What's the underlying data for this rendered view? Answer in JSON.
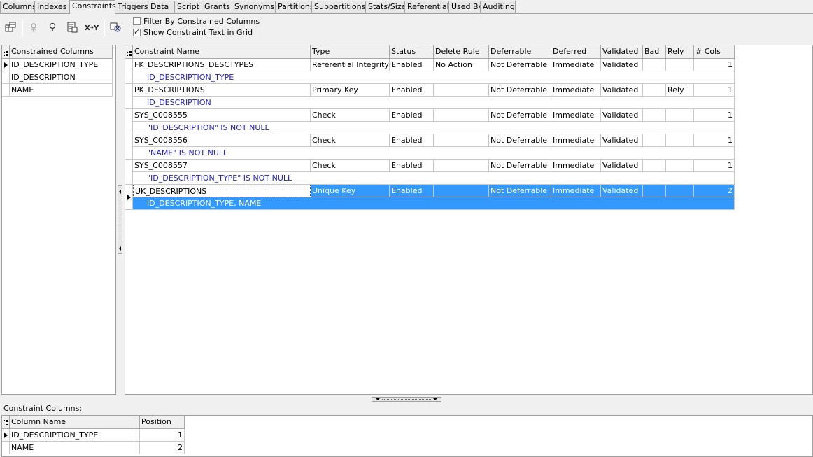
{
  "tabs": [
    "Columns",
    "Indexes",
    "Constraints",
    "Triggers",
    "Data",
    "Script",
    "Grants",
    "Synonyms",
    "Partitions",
    "Subpartitions",
    "Stats/Size",
    "Referential",
    "Used By",
    "Auditing"
  ],
  "active_tab": "Constraints",
  "options": {
    "filter_label": "Filter By Constrained Columns",
    "filter_checked": false,
    "show_text_label": "Show Constraint Text in Grid",
    "show_text_checked": true
  },
  "left_grid": {
    "header": "Constrained Columns",
    "rows": [
      "ID_DESCRIPTION_TYPE",
      "ID_DESCRIPTION",
      "NAME"
    ]
  },
  "main_grid": {
    "headers": [
      "Constraint Name",
      "Type",
      "Status",
      "Delete Rule",
      "Deferrable",
      "Deferred",
      "Validated",
      "Bad",
      "Rely",
      "# Cols"
    ],
    "rows": [
      {
        "name": "FK_DESCRIPTIONS_DESCTYPES",
        "type": "Referential Integrity",
        "status": "Enabled",
        "delete_rule": "No Action",
        "deferrable": "Not Deferrable",
        "deferred": "Immediate",
        "validated": "Validated",
        "bad": "",
        "rely": "",
        "cols": "1",
        "text": "ID_DESCRIPTION_TYPE"
      },
      {
        "name": "PK_DESCRIPTIONS",
        "type": "Primary Key",
        "status": "Enabled",
        "delete_rule": "",
        "deferrable": "Not Deferrable",
        "deferred": "Immediate",
        "validated": "Validated",
        "bad": "",
        "rely": "Rely",
        "cols": "1",
        "text": "ID_DESCRIPTION"
      },
      {
        "name": "SYS_C008555",
        "type": "Check",
        "status": "Enabled",
        "delete_rule": "",
        "deferrable": "Not Deferrable",
        "deferred": "Immediate",
        "validated": "Validated",
        "bad": "",
        "rely": "",
        "cols": "1",
        "text": "\"ID_DESCRIPTION\" IS NOT NULL"
      },
      {
        "name": "SYS_C008556",
        "type": "Check",
        "status": "Enabled",
        "delete_rule": "",
        "deferrable": "Not Deferrable",
        "deferred": "Immediate",
        "validated": "Validated",
        "bad": "",
        "rely": "",
        "cols": "1",
        "text": "\"NAME\" IS NOT NULL"
      },
      {
        "name": "SYS_C008557",
        "type": "Check",
        "status": "Enabled",
        "delete_rule": "",
        "deferrable": "Not Deferrable",
        "deferred": "Immediate",
        "validated": "Validated",
        "bad": "",
        "rely": "",
        "cols": "1",
        "text": "\"ID_DESCRIPTION_TYPE\" IS NOT NULL"
      },
      {
        "name": "UK_DESCRIPTIONS",
        "type": "Unique Key",
        "status": "Enabled",
        "delete_rule": "",
        "deferrable": "Not Deferrable",
        "deferred": "Immediate",
        "validated": "Validated",
        "bad": "",
        "rely": "",
        "cols": "2",
        "text": "ID_DESCRIPTION_TYPE, NAME"
      }
    ],
    "selected_row": 5
  },
  "bottom": {
    "label": "Constraint Columns:",
    "headers": [
      "Column Name",
      "Position"
    ],
    "rows": [
      {
        "column": "ID_DESCRIPTION_TYPE",
        "position": "1"
      },
      {
        "column": "NAME",
        "position": "2"
      }
    ]
  },
  "toolbar_icons": [
    "table-constraints-icon",
    "disable-icon",
    "enable-icon",
    "script-icon",
    "xy-icon",
    "drop-icon"
  ],
  "colors": {
    "selection": "#3399ff",
    "constraint_text": "#2020c0"
  }
}
